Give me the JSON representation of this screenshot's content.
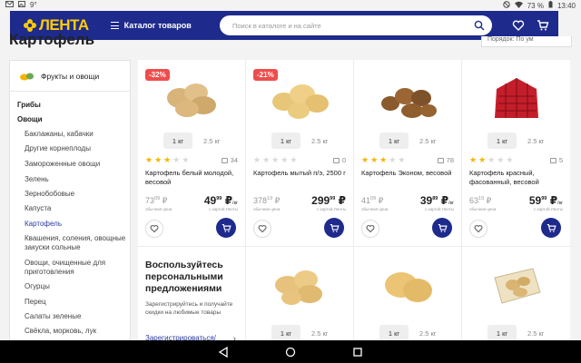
{
  "status": {
    "left_icons": [
      "gmail-icon",
      "photo-icon"
    ],
    "left_text": "9°",
    "battery": "73 %",
    "time": "13:40"
  },
  "header": {
    "logo": "ЛЕНТА",
    "catalog": "Каталог товаров",
    "search_placeholder": "Поиск в каталоге и на сайте",
    "colors": {
      "bar": "#1e2a8c",
      "logo": "#ffcc00",
      "accent_red": "#ee4d4d"
    }
  },
  "page": {
    "title": "Картофель",
    "sort": "Порядок: По ум"
  },
  "sidebar": {
    "category": "Фрукты и овощи",
    "items": [
      {
        "label": "Грибы",
        "level": 0,
        "bold": true
      },
      {
        "label": "Овощи",
        "level": 0,
        "bold": true
      },
      {
        "label": "Баклажаны, кабачки",
        "level": 1
      },
      {
        "label": "Другие корнеплоды",
        "level": 1
      },
      {
        "label": "Замороженные овощи",
        "level": 1
      },
      {
        "label": "Зелень",
        "level": 1
      },
      {
        "label": "Зернобобовые",
        "level": 1
      },
      {
        "label": "Капуста",
        "level": 1
      },
      {
        "label": "Картофель",
        "level": 1,
        "active": true
      },
      {
        "label": "Квашения, соления, овощные закуски сольные",
        "level": 1
      },
      {
        "label": "Овощи, очищенные для приготовления",
        "level": 1
      },
      {
        "label": "Огурцы",
        "level": 1
      },
      {
        "label": "Перец",
        "level": 1
      },
      {
        "label": "Салаты зеленые",
        "level": 1
      },
      {
        "label": "Свёкла, морковь, лук",
        "level": 1
      }
    ]
  },
  "products": [
    {
      "badge": "-32%",
      "unit": "1 кг",
      "weight": "2.5 кг",
      "rating": 3,
      "reviews": "34",
      "name": "Картофель белый молодой, весовой",
      "old_int": "73",
      "old_dec": "09",
      "new_int": "49",
      "new_dec": "99",
      "old_cap": "обычная цена",
      "new_cap": "с картой Ленты",
      "per": "/кг",
      "cur": "₽"
    },
    {
      "badge": "-21%",
      "unit": "1 кг",
      "weight": "2.5 кг",
      "rating": 0,
      "reviews": "0",
      "name": "Картофель мытый п/э, 2500 г",
      "old_int": "378",
      "old_dec": "19",
      "new_int": "299",
      "new_dec": "99",
      "old_cap": "обычная цена",
      "new_cap": "с картой Ленты",
      "per": "",
      "cur": "₽"
    },
    {
      "badge": "",
      "unit": "1 кг",
      "weight": "2.5 кг",
      "rating": 3,
      "reviews": "78",
      "name": "Картофель Эконом, весовой",
      "old_int": "41",
      "old_dec": "09",
      "new_int": "39",
      "new_dec": "89",
      "old_cap": "обычная цена",
      "new_cap": "с картой Ленты",
      "per": "/кг",
      "cur": "₽"
    },
    {
      "badge": "",
      "unit": "1 кг",
      "weight": "2.5 кг",
      "rating": 2,
      "reviews": "5",
      "name": "Картофель красный, фасованный, весовой",
      "old_int": "63",
      "old_dec": "19",
      "new_int": "59",
      "new_dec": "99",
      "old_cap": "обычная цена",
      "new_cap": "с картой Ленты",
      "per": "/кг",
      "cur": "₽"
    }
  ],
  "promo": {
    "title": "Воспользуйтесь персональными предложениями",
    "text": "Зарегистрируйтесь и получайте скидки на любимые товары",
    "link": "Зарегистрироваться/войти"
  },
  "row2": [
    {
      "unit": "1 кг",
      "weight": "2.5 кг"
    },
    {
      "unit": "1 кг",
      "weight": "2.5 кг"
    },
    {
      "unit": "1 кг",
      "weight": "2.5 кг"
    }
  ]
}
